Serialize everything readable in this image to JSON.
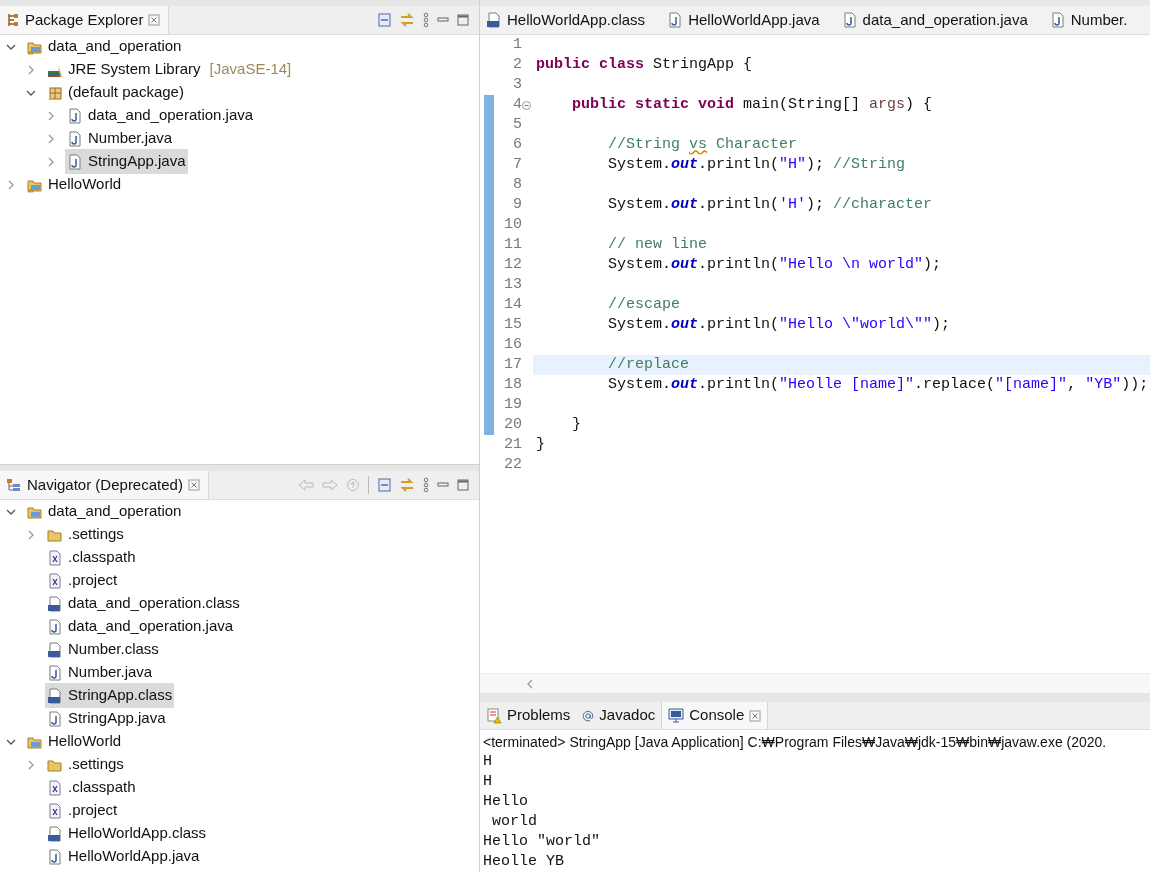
{
  "package_explorer": {
    "title": "Package Explorer",
    "tree": [
      {
        "kind": "project",
        "label": "data_and_operation",
        "expanded": true,
        "selected": false,
        "children": [
          {
            "kind": "library",
            "label": "JRE System Library",
            "suffix": "[JavaSE-14]",
            "expanded": false,
            "selected": false
          },
          {
            "kind": "package",
            "label": "(default package)",
            "expanded": true,
            "selected": false,
            "children": [
              {
                "kind": "java",
                "label": "data_and_operation.java",
                "expanded": false,
                "selected": false
              },
              {
                "kind": "java",
                "label": "Number.java",
                "expanded": false,
                "selected": false
              },
              {
                "kind": "java",
                "label": "StringApp.java",
                "expanded": false,
                "selected": true
              }
            ]
          }
        ]
      },
      {
        "kind": "project",
        "label": "HelloWorld",
        "expanded": false,
        "selected": false
      }
    ]
  },
  "navigator": {
    "title": "Navigator (Deprecated)",
    "tree": [
      {
        "kind": "folder-project",
        "label": "data_and_operation",
        "expanded": true,
        "selected": false,
        "children": [
          {
            "kind": "folder",
            "label": ".settings",
            "expanded": false,
            "selected": false
          },
          {
            "kind": "xml",
            "label": ".classpath",
            "selected": false
          },
          {
            "kind": "xml",
            "label": ".project",
            "selected": false
          },
          {
            "kind": "class",
            "label": "data_and_operation.class",
            "selected": false
          },
          {
            "kind": "java",
            "label": "data_and_operation.java",
            "selected": false
          },
          {
            "kind": "class",
            "label": "Number.class",
            "selected": false
          },
          {
            "kind": "java",
            "label": "Number.java",
            "selected": false
          },
          {
            "kind": "class",
            "label": "StringApp.class",
            "selected": true
          },
          {
            "kind": "java",
            "label": "StringApp.java",
            "selected": false
          }
        ]
      },
      {
        "kind": "folder-project",
        "label": "HelloWorld",
        "expanded": true,
        "selected": false,
        "children": [
          {
            "kind": "folder",
            "label": ".settings",
            "expanded": false,
            "selected": false
          },
          {
            "kind": "xml",
            "label": ".classpath",
            "selected": false
          },
          {
            "kind": "xml",
            "label": ".project",
            "selected": false
          },
          {
            "kind": "class",
            "label": "HelloWorldApp.class",
            "selected": false
          },
          {
            "kind": "java",
            "label": "HelloWorldApp.java",
            "selected": false
          }
        ]
      }
    ]
  },
  "editor": {
    "tabs": [
      {
        "kind": "class",
        "label": "HelloWorldApp.class",
        "selected": false
      },
      {
        "kind": "java",
        "label": "HelloWorldApp.java",
        "selected": false
      },
      {
        "kind": "java",
        "label": "data_and_operation.java",
        "selected": false
      },
      {
        "kind": "java",
        "label": "Number.",
        "selected": false
      }
    ],
    "lines": [
      {
        "number": "1",
        "changed": false,
        "selected": false
      },
      {
        "number": "2",
        "changed": false,
        "selected": false,
        "tokens": [
          {
            "kind": "keyword",
            "text": "public"
          },
          {
            "kind": "keyword",
            "text": " class"
          },
          {
            "kind": "plain",
            "text": " StringApp {"
          }
        ]
      },
      {
        "number": "3",
        "changed": false,
        "selected": false
      },
      {
        "number": "4",
        "changed": true,
        "foldable": true,
        "selected": false,
        "tokens": [
          {
            "kind": "keyword",
            "text": "    public"
          },
          {
            "kind": "keyword",
            "text": " static"
          },
          {
            "kind": "keyword",
            "text": " void"
          },
          {
            "kind": "plain",
            "text": " main(String[] "
          },
          {
            "kind": "param",
            "text": "args"
          },
          {
            "kind": "plain",
            "text": ") {"
          }
        ]
      },
      {
        "number": "5",
        "changed": true,
        "selected": false
      },
      {
        "number": "6",
        "changed": true,
        "selected": false,
        "tokens": [
          {
            "kind": "comment",
            "text": "        //String "
          },
          {
            "kind": "comment-misspelled",
            "text": "vs"
          },
          {
            "kind": "comment",
            "text": " Character"
          }
        ]
      },
      {
        "number": "7",
        "changed": true,
        "selected": false,
        "tokens": [
          {
            "kind": "plain",
            "text": "        System."
          },
          {
            "kind": "field",
            "text": "out"
          },
          {
            "kind": "plain",
            "text": ".println("
          },
          {
            "kind": "string",
            "text": "\"H\""
          },
          {
            "kind": "plain",
            "text": "); "
          },
          {
            "kind": "comment",
            "text": "//String"
          }
        ]
      },
      {
        "number": "8",
        "changed": true,
        "selected": false
      },
      {
        "number": "9",
        "changed": true,
        "selected": false,
        "tokens": [
          {
            "kind": "plain",
            "text": "        System."
          },
          {
            "kind": "field",
            "text": "out"
          },
          {
            "kind": "plain",
            "text": ".println("
          },
          {
            "kind": "string",
            "text": "'H'"
          },
          {
            "kind": "plain",
            "text": "); "
          },
          {
            "kind": "comment",
            "text": "//character"
          }
        ]
      },
      {
        "number": "10",
        "changed": true,
        "selected": false
      },
      {
        "number": "11",
        "changed": true,
        "selected": false,
        "tokens": [
          {
            "kind": "comment",
            "text": "        // new line"
          }
        ]
      },
      {
        "number": "12",
        "changed": true,
        "selected": false,
        "tokens": [
          {
            "kind": "plain",
            "text": "        System."
          },
          {
            "kind": "field",
            "text": "out"
          },
          {
            "kind": "plain",
            "text": ".println("
          },
          {
            "kind": "string",
            "text": "\"Hello \\n world\""
          },
          {
            "kind": "plain",
            "text": ");"
          }
        ]
      },
      {
        "number": "13",
        "changed": true,
        "selected": false
      },
      {
        "number": "14",
        "changed": true,
        "selected": false,
        "tokens": [
          {
            "kind": "comment",
            "text": "        //escape"
          }
        ]
      },
      {
        "number": "15",
        "changed": true,
        "selected": false,
        "tokens": [
          {
            "kind": "plain",
            "text": "        System."
          },
          {
            "kind": "field",
            "text": "out"
          },
          {
            "kind": "plain",
            "text": ".println("
          },
          {
            "kind": "string",
            "text": "\"Hello \\\"world\\\"\""
          },
          {
            "kind": "plain",
            "text": ");"
          }
        ]
      },
      {
        "number": "16",
        "changed": true,
        "selected": false
      },
      {
        "number": "17",
        "changed": true,
        "selected": true,
        "tokens": [
          {
            "kind": "comment",
            "text": "        //replace"
          }
        ]
      },
      {
        "number": "18",
        "changed": true,
        "selected": false,
        "tokens": [
          {
            "kind": "plain",
            "text": "        System."
          },
          {
            "kind": "field",
            "text": "out"
          },
          {
            "kind": "plain",
            "text": ".println("
          },
          {
            "kind": "string",
            "text": "\"Heolle [name]\""
          },
          {
            "kind": "plain",
            "text": ".replace("
          },
          {
            "kind": "string",
            "text": "\"[name]\""
          },
          {
            "kind": "plain",
            "text": ", "
          },
          {
            "kind": "string",
            "text": "\"YB\""
          },
          {
            "kind": "plain",
            "text": "));"
          }
        ]
      },
      {
        "number": "19",
        "changed": true,
        "selected": false
      },
      {
        "number": "20",
        "changed": true,
        "selected": false,
        "tokens": [
          {
            "kind": "plain",
            "text": "    }"
          }
        ]
      },
      {
        "number": "21",
        "changed": false,
        "selected": false,
        "tokens": [
          {
            "kind": "plain",
            "text": "}"
          }
        ]
      },
      {
        "number": "22",
        "changed": false,
        "selected": false
      }
    ]
  },
  "bottom": {
    "tabs": [
      {
        "kind": "problems",
        "label": "Problems",
        "selected": false
      },
      {
        "kind": "javadoc",
        "label": "Javadoc",
        "selected": false
      },
      {
        "kind": "console",
        "label": "Console",
        "selected": true
      }
    ],
    "console_header": "<terminated> StringApp [Java Application] C:₩Program Files₩Java₩jdk-15₩bin₩javaw.exe  (2020.",
    "output": [
      "H",
      "H",
      "Hello",
      " world",
      "Hello \"world\"",
      "Heolle YB"
    ]
  }
}
